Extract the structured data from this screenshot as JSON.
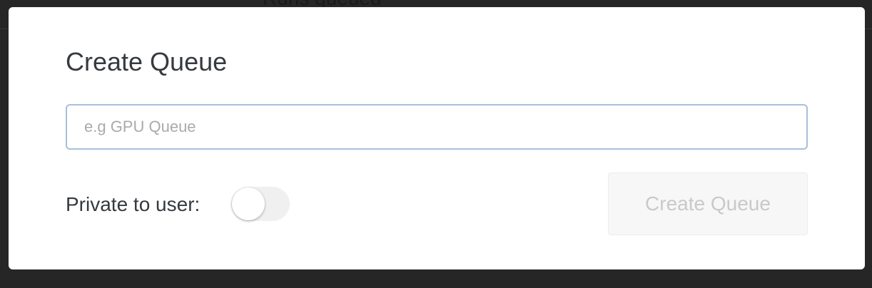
{
  "background": {
    "partial_heading": "Runs queued"
  },
  "modal": {
    "title": "Create Queue",
    "name_input": {
      "value": "",
      "placeholder": "e.g GPU Queue"
    },
    "private_toggle": {
      "label": "Private to user:",
      "checked": false
    },
    "create_button": {
      "label": "Create Queue",
      "disabled": true
    }
  },
  "colors": {
    "overlay": "#262626",
    "modal_bg": "#ffffff",
    "input_border": "#a8bfdc",
    "title_text": "#363a3e",
    "disabled_button_bg": "#f7f7f7",
    "disabled_button_text": "#c8c9ca"
  }
}
